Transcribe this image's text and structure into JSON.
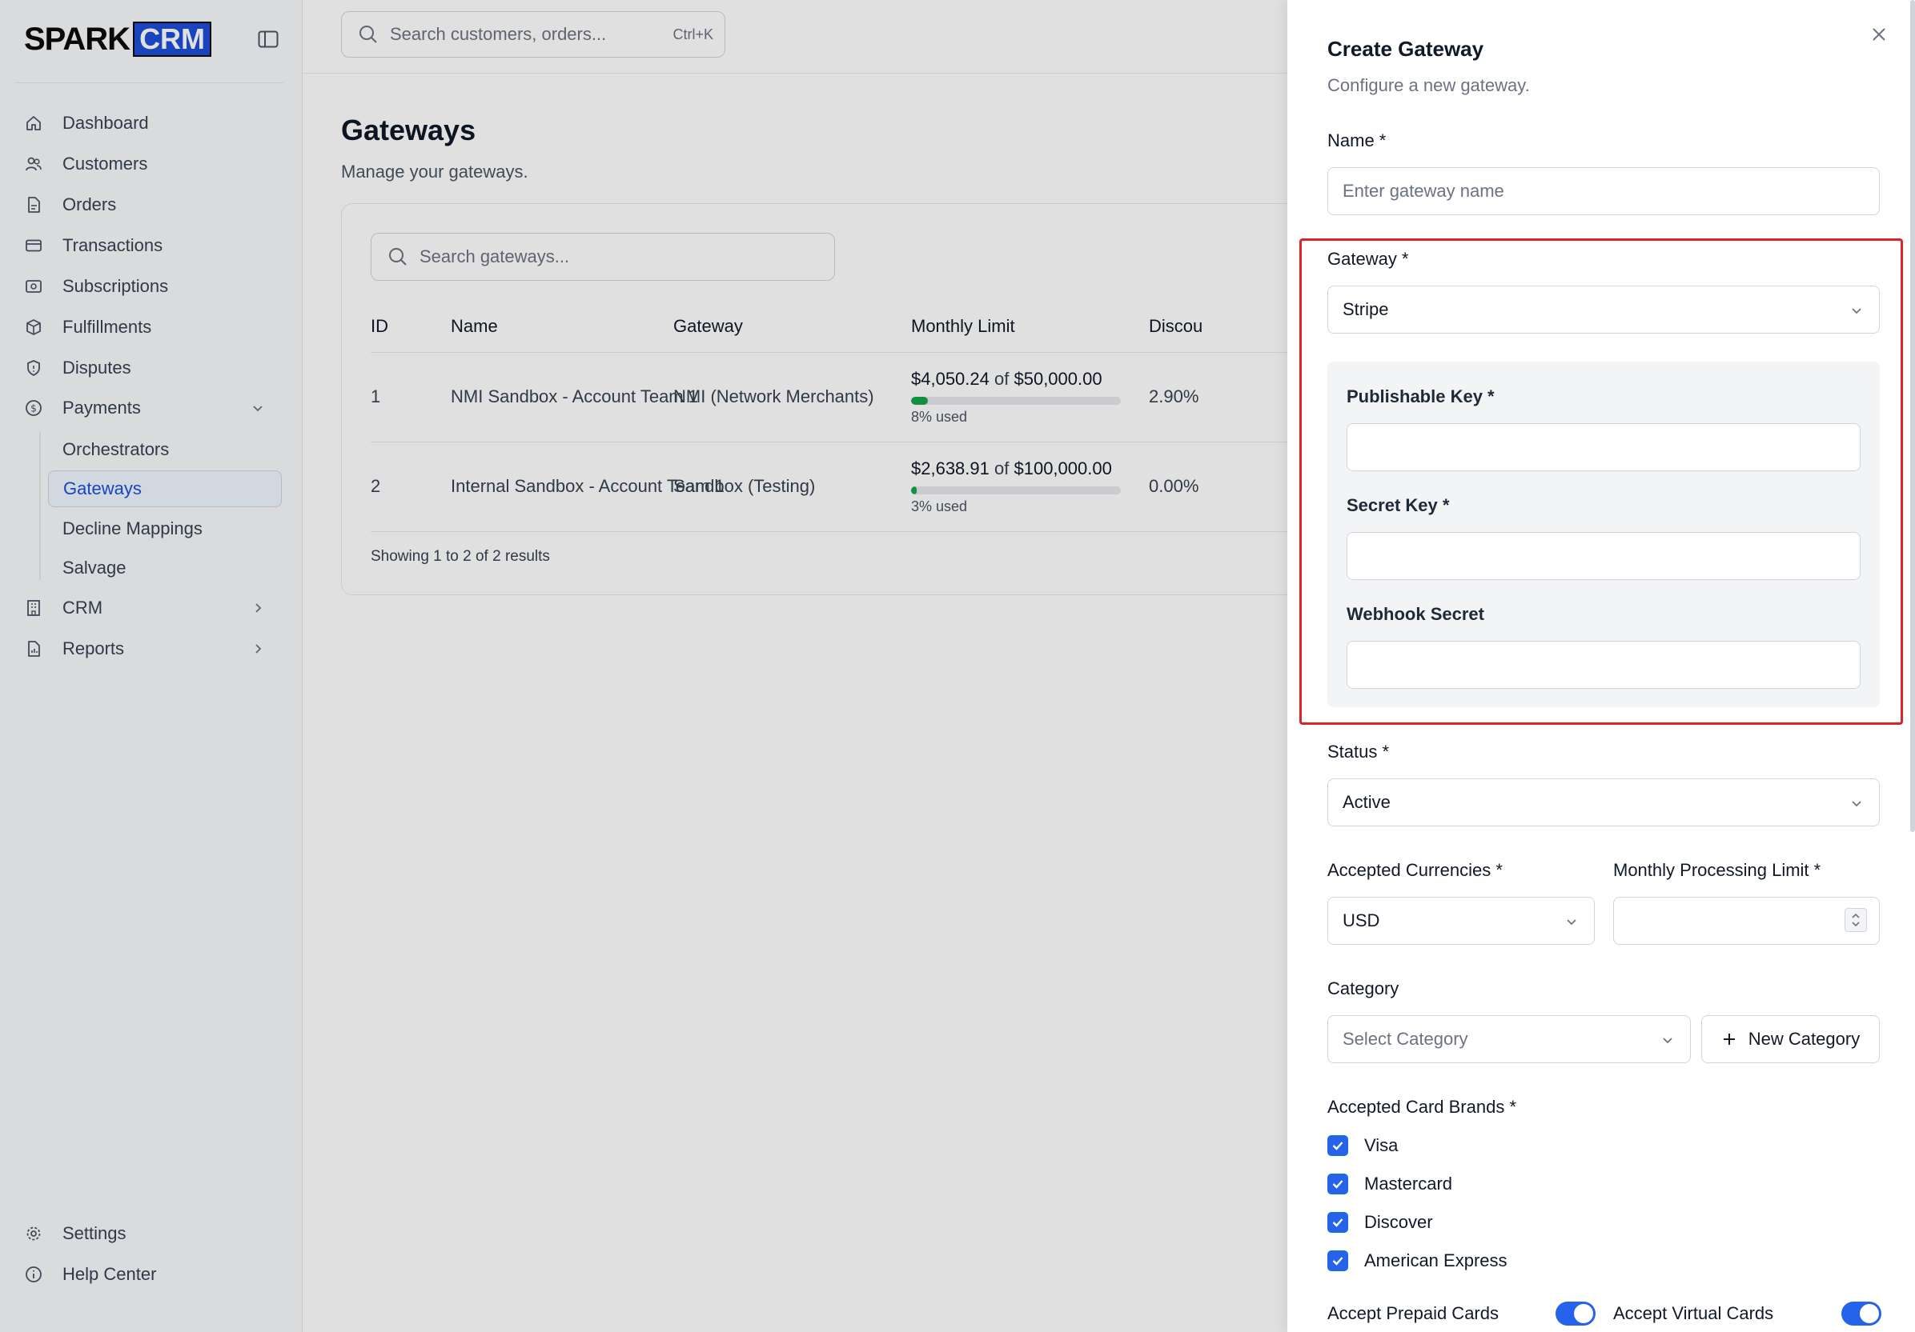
{
  "brand": {
    "name_part1": "SPARK",
    "name_part2": "CRM",
    "accent": "#1d4ed8"
  },
  "topbar": {
    "search_placeholder": "Search customers, orders...",
    "shortcut": "Ctrl+K"
  },
  "sidebar": {
    "items": [
      {
        "label": "Dashboard",
        "icon": "home-icon"
      },
      {
        "label": "Customers",
        "icon": "users-icon"
      },
      {
        "label": "Orders",
        "icon": "document-icon"
      },
      {
        "label": "Transactions",
        "icon": "credit-card-icon"
      },
      {
        "label": "Subscriptions",
        "icon": "subscription-icon"
      },
      {
        "label": "Fulfillments",
        "icon": "package-icon"
      },
      {
        "label": "Disputes",
        "icon": "shield-icon"
      },
      {
        "label": "Payments",
        "icon": "dollar-circle-icon"
      }
    ],
    "payments_sub": [
      "Orchestrators",
      "Gateways",
      "Decline Mappings",
      "Salvage"
    ],
    "active_sub": "Gateways",
    "more_items": [
      {
        "label": "CRM",
        "icon": "building-icon"
      },
      {
        "label": "Reports",
        "icon": "report-icon"
      }
    ],
    "footer": [
      {
        "label": "Settings",
        "icon": "gear-icon"
      },
      {
        "label": "Help Center",
        "icon": "help-circle-icon"
      }
    ]
  },
  "page": {
    "title": "Gateways",
    "subtitle": "Manage your gateways.",
    "search_placeholder": "Search gateways...",
    "columns": [
      "ID",
      "Name",
      "Gateway",
      "Monthly Limit",
      "Discou"
    ],
    "rows": [
      {
        "id": "1",
        "name": "NMI Sandbox - Account Team 1",
        "gateway": "NMI (Network Merchants)",
        "used_amount": "$4,050.24",
        "of": "of",
        "limit": "$50,000.00",
        "used_label": "8% used",
        "used_fraction": 0.081,
        "discount": "2.90%"
      },
      {
        "id": "2",
        "name": "Internal Sandbox - Account Team 1",
        "gateway": "Sandbox (Testing)",
        "used_amount": "$2,638.91",
        "of": "of",
        "limit": "$100,000.00",
        "used_label": "3% used",
        "used_fraction": 0.026,
        "discount": "0.00%"
      }
    ],
    "showing": "Showing 1 to 2 of 2 results"
  },
  "drawer": {
    "title": "Create Gateway",
    "subtitle": "Configure a new gateway.",
    "name_label": "Name *",
    "name_placeholder": "Enter gateway name",
    "gateway_label": "Gateway *",
    "gateway_value": "Stripe",
    "publishable_key_label": "Publishable Key *",
    "secret_key_label": "Secret Key *",
    "webhook_secret_label": "Webhook Secret",
    "status_label": "Status *",
    "status_value": "Active",
    "currencies_label": "Accepted Currencies *",
    "currencies_value": "USD",
    "monthly_limit_label": "Monthly Processing Limit *",
    "category_label": "Category",
    "category_placeholder": "Select Category",
    "new_category_label": "New Category",
    "card_brands_label": "Accepted Card Brands *",
    "card_brands": [
      "Visa",
      "Mastercard",
      "Discover",
      "American Express"
    ],
    "accept_prepaid_label": "Accept Prepaid Cards",
    "accept_virtual_label": "Accept Virtual Cards"
  }
}
